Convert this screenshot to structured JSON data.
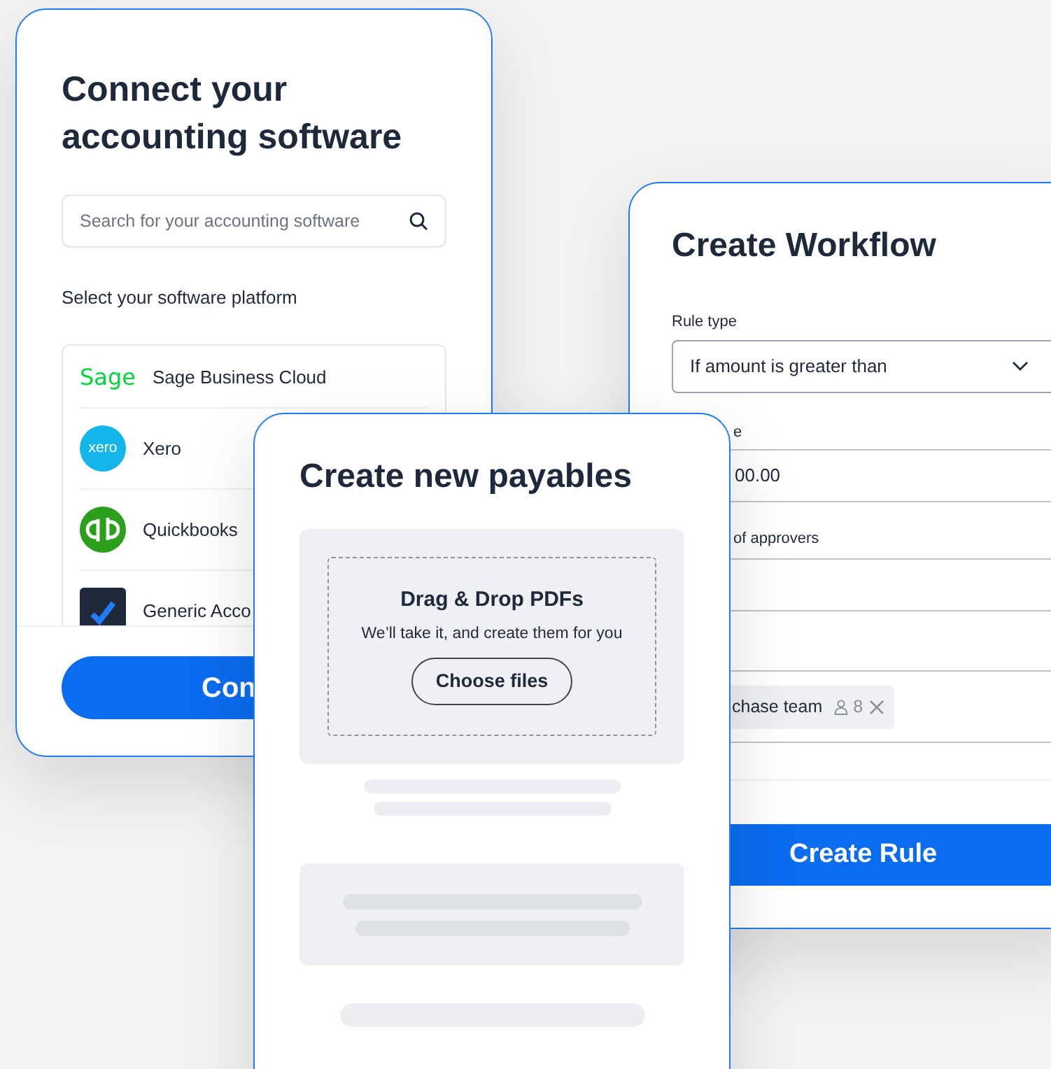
{
  "connect_card": {
    "title": "Connect your accounting software",
    "search": {
      "placeholder": "Search for your accounting software"
    },
    "section_label": "Select your software platform",
    "platforms": [
      {
        "name": "Sage Business Cloud",
        "kind": "sage",
        "logo_text": "Sage"
      },
      {
        "name": "Xero",
        "kind": "xero",
        "logo_text": "xero"
      },
      {
        "name": "Quickbooks",
        "kind": "quickbooks"
      },
      {
        "name": "Generic Acco",
        "kind": "generic"
      }
    ],
    "button": "Con"
  },
  "workflow_card": {
    "title": "Create Workflow",
    "rule_type": {
      "label": "Rule type",
      "value": "If amount is greater than"
    },
    "value_field": {
      "label": "e",
      "value": "00.00"
    },
    "approvers": {
      "label": "of approvers"
    },
    "chip": {
      "label": "chase team",
      "count": "8"
    },
    "button": "Create Rule"
  },
  "payables_card": {
    "title": "Create new payables",
    "dropzone": {
      "title": "Drag & Drop PDFs",
      "subtitle": "We’ll take it, and create them for you",
      "button": "Choose files"
    }
  }
}
